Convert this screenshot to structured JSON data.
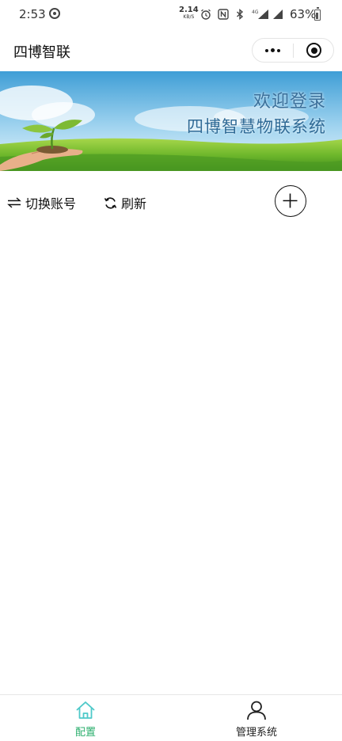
{
  "status_bar": {
    "time": "2:53",
    "network_speed": "2.14",
    "network_unit": "KB/S",
    "network_type": "4G",
    "battery": "63%"
  },
  "nav": {
    "title": "四博智联"
  },
  "banner": {
    "line1": "欢迎登录",
    "line2": "四博智慧物联系统"
  },
  "toolbar": {
    "switch_label": "切换账号",
    "refresh_label": "刷新"
  },
  "tab_bar": {
    "active_color": "#2aae6c",
    "home_icon_color": "#4ec9c9",
    "tabs": [
      {
        "label": "配置",
        "icon": "home-icon",
        "active": true
      },
      {
        "label": "管理系统",
        "icon": "user-icon",
        "active": false
      }
    ]
  }
}
